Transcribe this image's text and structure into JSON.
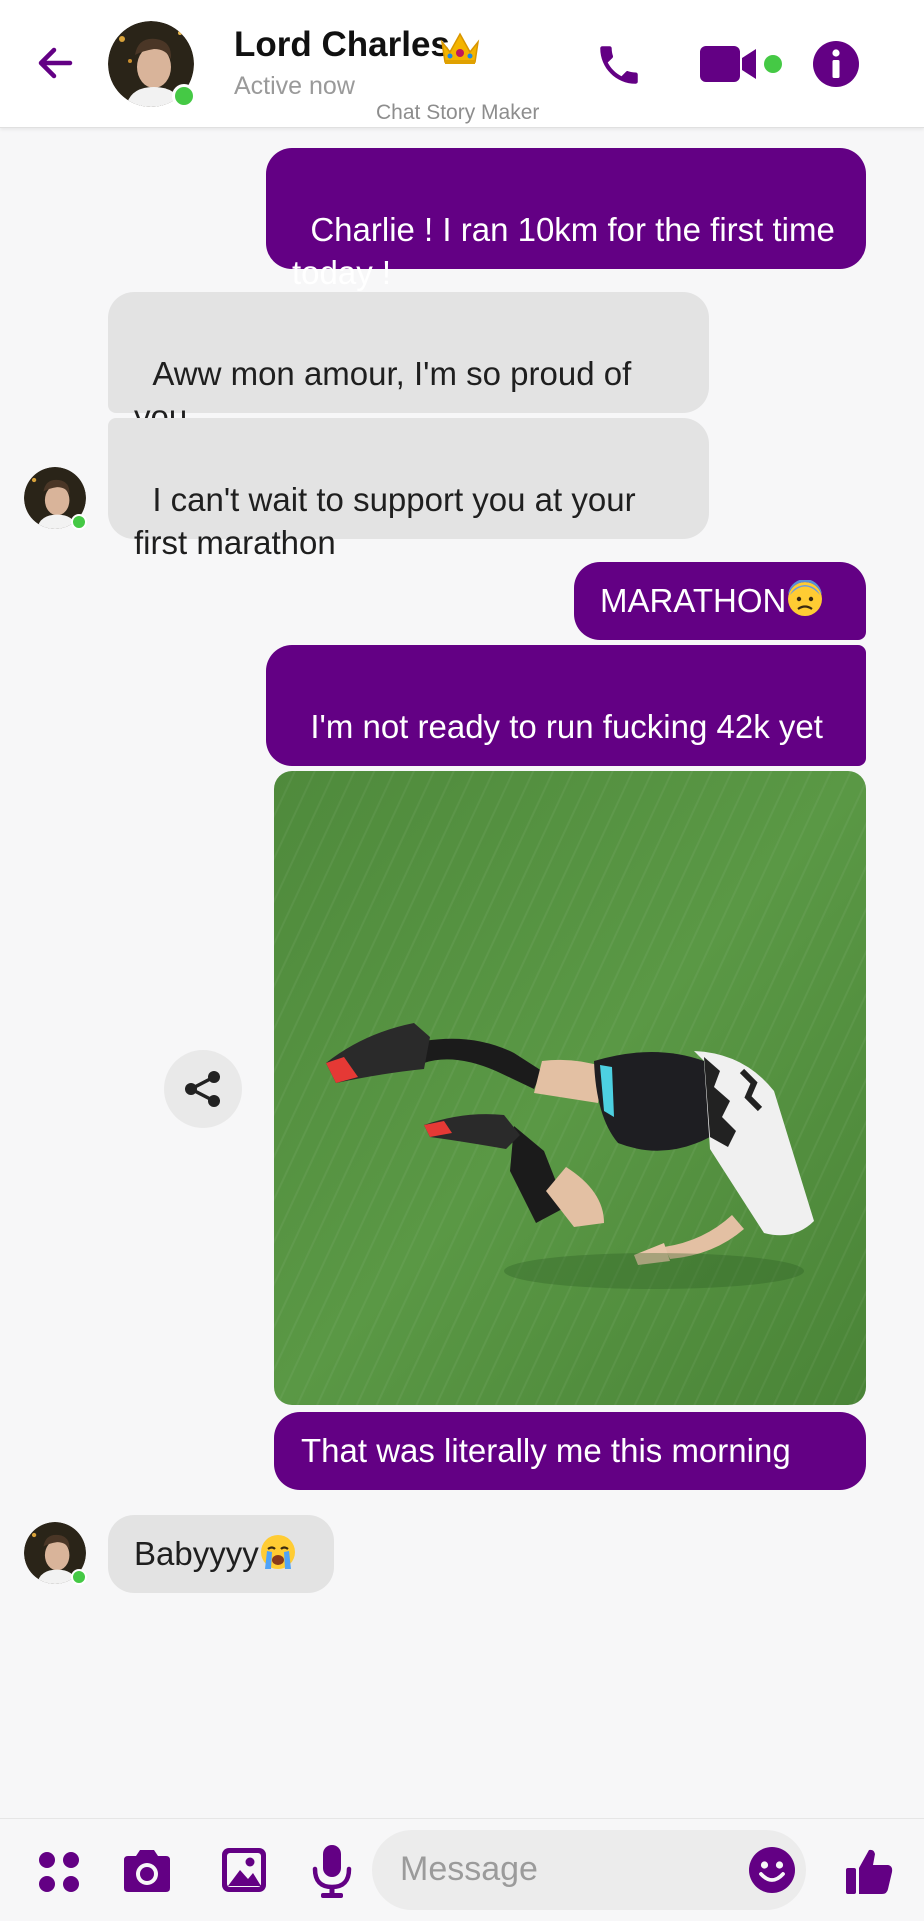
{
  "header": {
    "contact_name": "Lord Charles",
    "crown_emoji": "👑",
    "status": "Active now",
    "watermark": "Chat Story Maker",
    "icons": [
      "back-arrow-icon",
      "phone-icon",
      "video-camera-icon",
      "info-icon"
    ],
    "online": true
  },
  "messages": [
    {
      "from": "me",
      "text": "Charlie ! I ran 10km for the first time today !"
    },
    {
      "from": "them",
      "text": "Aww mon amour, I'm so proud of you",
      "emoji": "🤍"
    },
    {
      "from": "them",
      "text": "I can't wait to support you at your first marathon"
    },
    {
      "from": "me",
      "text": "MARATHON",
      "emoji": "😰"
    },
    {
      "from": "me",
      "text": "I'm not ready to run fucking 42k yet"
    },
    {
      "from": "me",
      "type": "image",
      "description_icon": "photo-message"
    },
    {
      "from": "me",
      "text": "That was literally me this morning"
    },
    {
      "from": "them",
      "text": "Babyyyy",
      "emoji": "😭"
    }
  ],
  "composer": {
    "placeholder": "Message",
    "icons": [
      "apps-icon",
      "camera-icon",
      "gallery-icon",
      "microphone-icon",
      "emoji-icon",
      "thumbs-up-icon"
    ]
  },
  "colors": {
    "accent": "#630084",
    "sent_bubble": "#630084",
    "received_bubble": "#e3e3e3",
    "online": "#45c945",
    "background": "#f7f7f8"
  }
}
